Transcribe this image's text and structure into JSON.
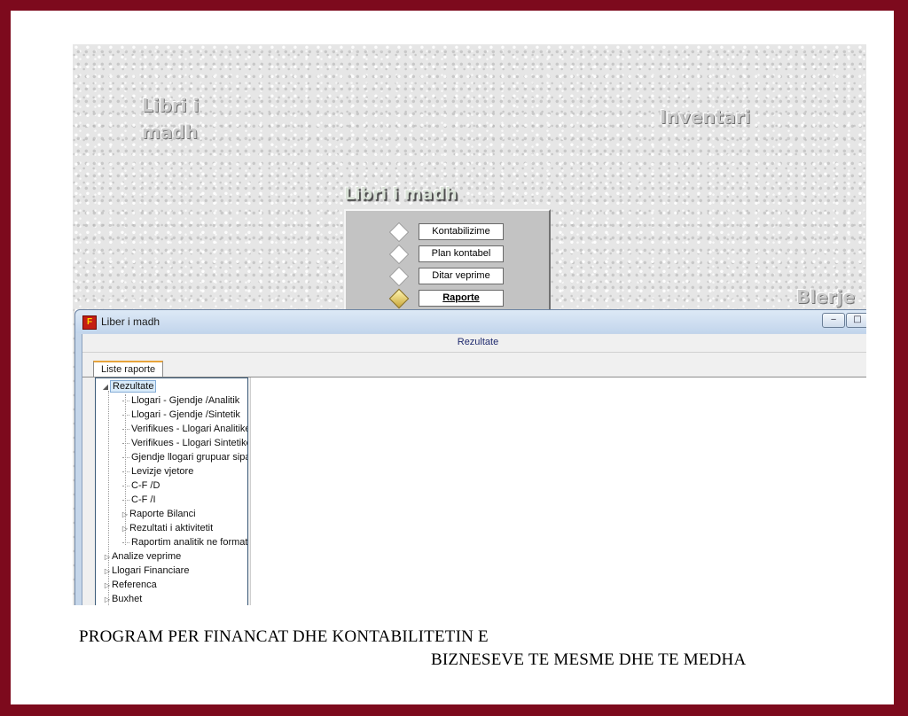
{
  "background_labels": {
    "libri_line1": "Libri i",
    "libri_line2": "madh",
    "inventari": "Inventari",
    "blerje": "Blerje"
  },
  "menu": {
    "title": "Libri i madh",
    "items": [
      {
        "label": "Kontabilizime"
      },
      {
        "label": "Plan kontabel"
      },
      {
        "label": "Ditar veprime"
      },
      {
        "label": "Raporte"
      }
    ]
  },
  "window": {
    "title": "Liber i madh",
    "icon_letter": "F",
    "header": "Rezultate",
    "tab": "Liste raporte",
    "minimize_glyph": "‒",
    "maximize_glyph": "□"
  },
  "tree": {
    "root": "Rezultate",
    "children": [
      {
        "label": "Llogari - Gjendje /Analitik"
      },
      {
        "label": "Llogari - Gjendje /Sintetik"
      },
      {
        "label": "Verifikues - Llogari Analitike"
      },
      {
        "label": "Verifikues - Llogari Sintetike"
      },
      {
        "label": "Gjendje llogari grupuar sipas"
      },
      {
        "label": "Levizje vjetore"
      },
      {
        "label": "C-F /D"
      },
      {
        "label": "C-F /I"
      },
      {
        "label": "Raporte Bilanci"
      },
      {
        "label": "Rezultati i aktivitetit"
      },
      {
        "label": "Raportim analitik ne format"
      }
    ],
    "top_nodes": [
      {
        "label": "Analize veprime"
      },
      {
        "label": "Llogari Financiare"
      },
      {
        "label": "Referenca"
      },
      {
        "label": "Buxhet"
      }
    ]
  },
  "caption": {
    "line1": "PROGRAM PER FINANCAT DHE KONTABILITETIN E",
    "line2": "BIZNESEVE TE MESME DHE TE MEDHA"
  },
  "colors": {
    "frame": "#7d0a1d",
    "window_border": "#6d84a3",
    "tab_accent": "#e7a33a"
  }
}
